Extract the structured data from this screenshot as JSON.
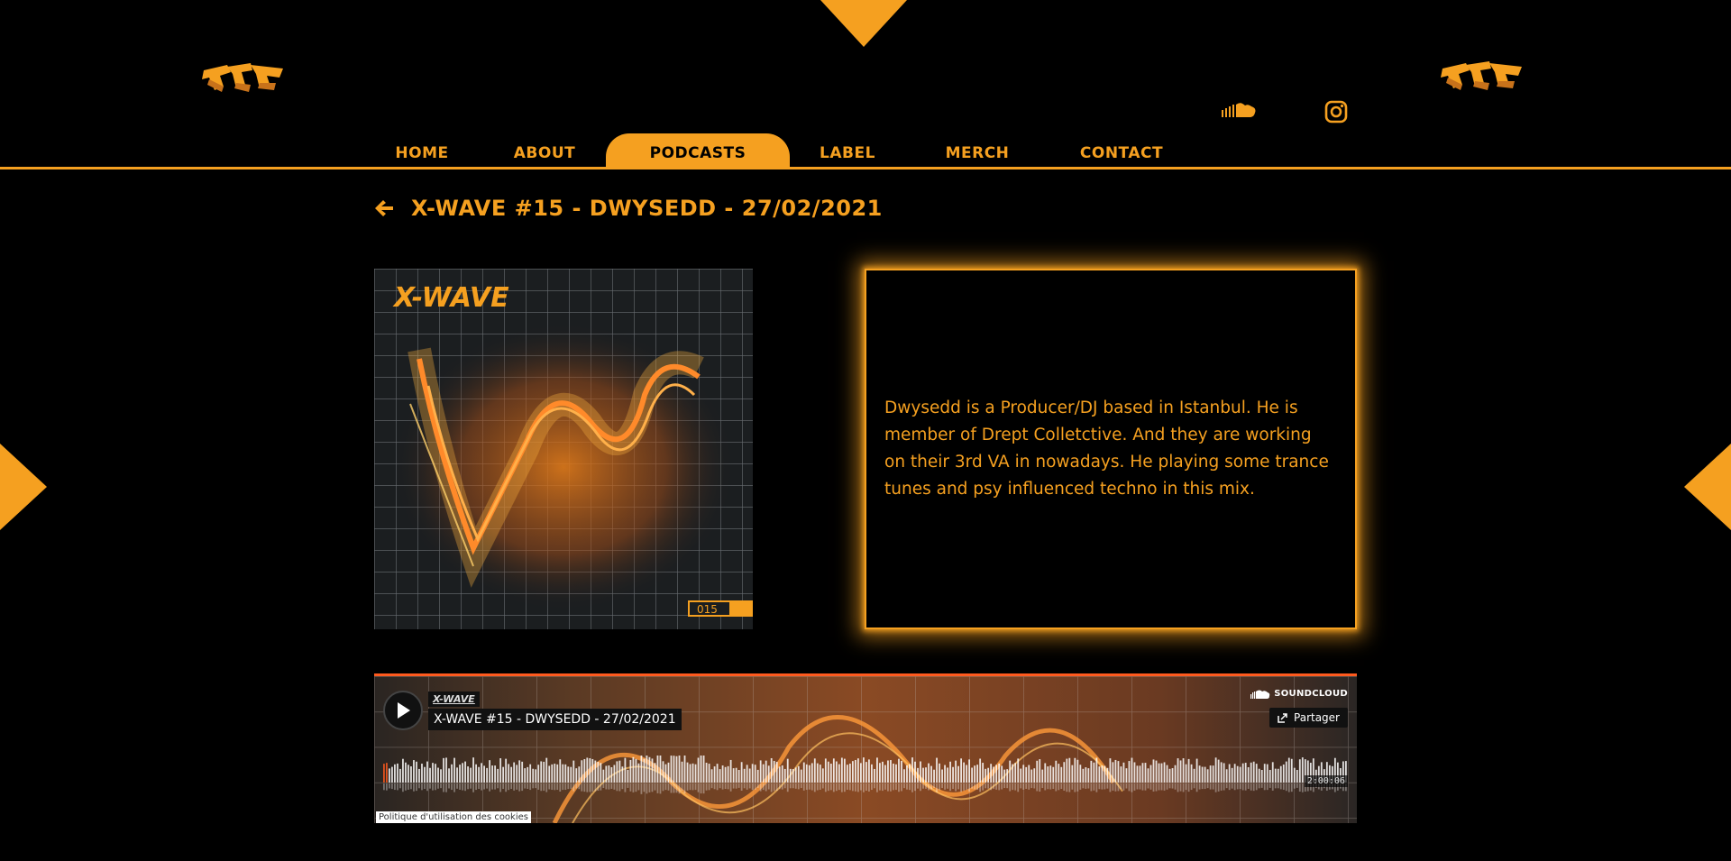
{
  "nav": {
    "items": [
      {
        "label": "HOME"
      },
      {
        "label": "ABOUT"
      },
      {
        "label": "PODCASTS",
        "active": true
      },
      {
        "label": "LABEL"
      },
      {
        "label": "MERCH"
      },
      {
        "label": "CONTACT"
      }
    ]
  },
  "social": {
    "icons": [
      "soundcloud-icon",
      "instagram-icon"
    ]
  },
  "podcast": {
    "title": "X-WAVE #15 - DWYSEDD - 27/02/2021",
    "cover": {
      "brand": "X-WAVE",
      "number": "015"
    },
    "description": "Dwysedd is a Producer/DJ based in Istanbul. He is member of Drept Colletctive. And they are working on their 3rd VA in nowadays. He playing some trance tunes and psy influenced techno in this mix."
  },
  "player": {
    "artist": "X-WAVE",
    "track_title": "X-WAVE #15 - DWYSEDD - 27/02/2021",
    "brand": "SOUNDCLOUD",
    "share_label": "Partager",
    "duration": "2:00:06",
    "cookie_label": "Politique d'utilisation des cookies"
  },
  "colors": {
    "accent": "#f5a020",
    "background": "#000000",
    "player_progress": "#ff5a1e"
  }
}
